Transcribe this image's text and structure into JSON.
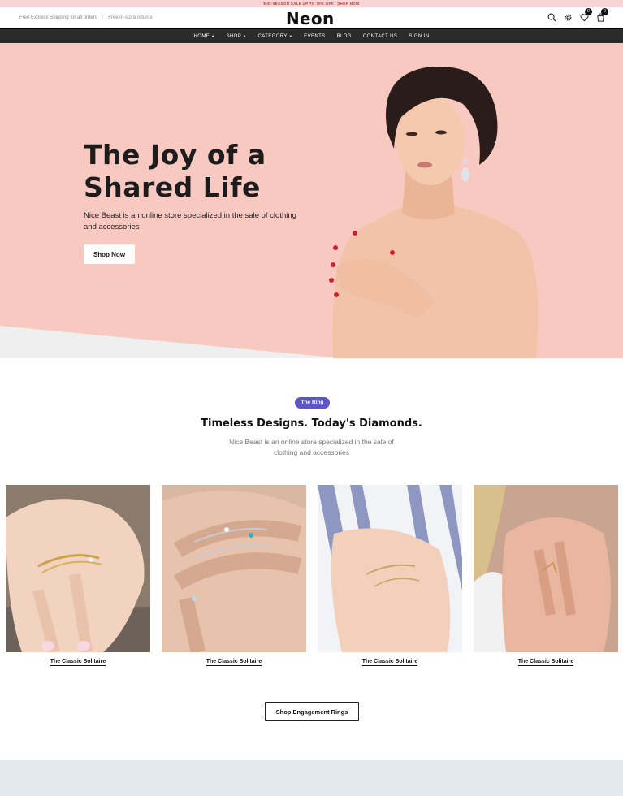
{
  "promo": {
    "text": "MID-SEASON SALE UP TO 70% OFF.",
    "link": "SHOP NOW"
  },
  "header": {
    "shipping": "Free Express Shipping for all orders",
    "returns": "Free in-store returns",
    "logo": "Neon",
    "wishlist_count": "0",
    "cart_count": "0"
  },
  "nav": {
    "items": [
      {
        "label": "HOME",
        "dropdown": true
      },
      {
        "label": "SHOP",
        "dropdown": true
      },
      {
        "label": "CATEGORY",
        "dropdown": true
      },
      {
        "label": "EVENTS",
        "dropdown": false
      },
      {
        "label": "BLOG",
        "dropdown": false
      },
      {
        "label": "CONTACT US",
        "dropdown": false
      },
      {
        "label": "SIGN IN",
        "dropdown": false
      }
    ]
  },
  "hero": {
    "title_line1": "The Joy of a",
    "title_line2": "Shared Life",
    "description": "Nice Beast is an online store specialized in the sale of clothing and accessories",
    "button": "Shop Now",
    "bg_color": "#f7c9c1"
  },
  "section": {
    "tag": "The Ring",
    "title": "Timeless Designs. Today's Diamonds.",
    "description": "Nice Beast is an online store specialized in the sale of clothing and accessories",
    "tag_color": "#5b55c5"
  },
  "products": [
    {
      "label": "The Classic Solitaire"
    },
    {
      "label": "The Classic Solitaire"
    },
    {
      "label": "The Classic Solitaire"
    },
    {
      "label": "The Classic Solitaire"
    }
  ],
  "cta": {
    "label": "Shop Engagement Rings"
  }
}
